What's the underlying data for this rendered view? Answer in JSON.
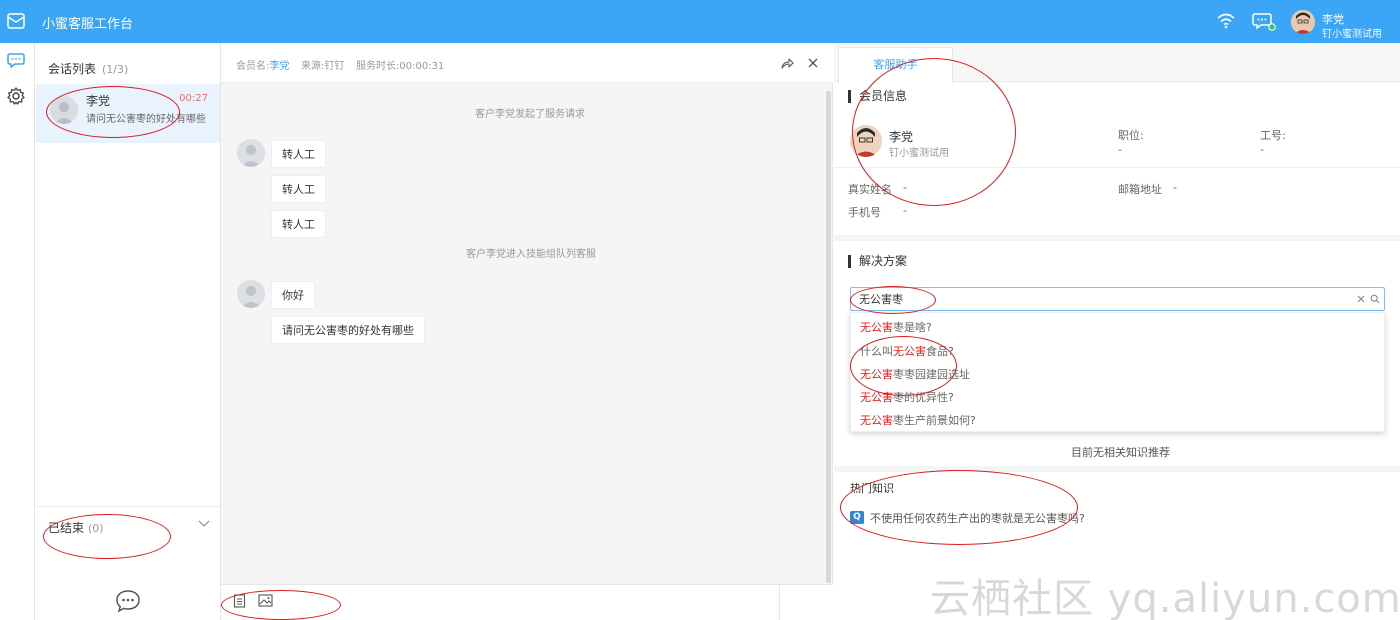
{
  "app": {
    "title": "小蜜客服工作台"
  },
  "user": {
    "name": "李党",
    "org": "钉小蜜测试用"
  },
  "sessions": {
    "heading": "会话列表",
    "count": "(1/3)",
    "items": [
      {
        "name": "李党",
        "time": "00:27",
        "preview": "请问无公害枣的好处有哪些"
      }
    ],
    "ended_label": "已结束",
    "ended_count": "(0)"
  },
  "chat": {
    "header": {
      "member_label": "会员名:",
      "member_value": "李党",
      "source_label": "来源:",
      "source_value": "钉钉",
      "duration_label": "服务时长:",
      "duration_value": "00:00:31"
    },
    "system_messages": [
      "客户李党发起了服务请求",
      "客户李党进入技能组队列客服"
    ],
    "messages": [
      "转人工",
      "转人工",
      "转人工",
      "你好",
      "请问无公害枣的好处有哪些"
    ]
  },
  "assistant": {
    "tab": "客服助手",
    "member_section": "会员信息",
    "member": {
      "name": "李党",
      "org": "钉小蜜测试用"
    },
    "fields": {
      "position_label": "职位:",
      "position_value": "-",
      "employee_no_label": "工号:",
      "employee_no_value": "-",
      "real_name_label": "真实姓名",
      "real_name_value": "-",
      "email_label": "邮箱地址",
      "email_value": "-",
      "phone_label": "手机号",
      "phone_value": "-"
    },
    "solution_section": "解决方案",
    "search_value": "无公害枣",
    "suggestions": [
      {
        "hl": "无公害",
        "rest": "枣是啥?"
      },
      {
        "pre": "什么叫",
        "hl": "无公害",
        "rest": "食品?"
      },
      {
        "hl": "无公害",
        "rest": "枣枣园建园选址"
      },
      {
        "hl": "无公害",
        "rest": "枣的优异性?"
      },
      {
        "hl": "无公害",
        "rest": "枣生产前景如何?"
      }
    ],
    "no_recommend": "目前无相关知识推荐",
    "hot_section": "热门知识",
    "hot_badge": "Q",
    "hot_question": "不使用任何农药生产出的枣就是无公害枣吗?"
  },
  "watermark": "云栖社区 yq.aliyun.com",
  "colors": {
    "primary": "#3ba6f5",
    "highlight": "#e02020",
    "annotation": "#d81e1e"
  }
}
